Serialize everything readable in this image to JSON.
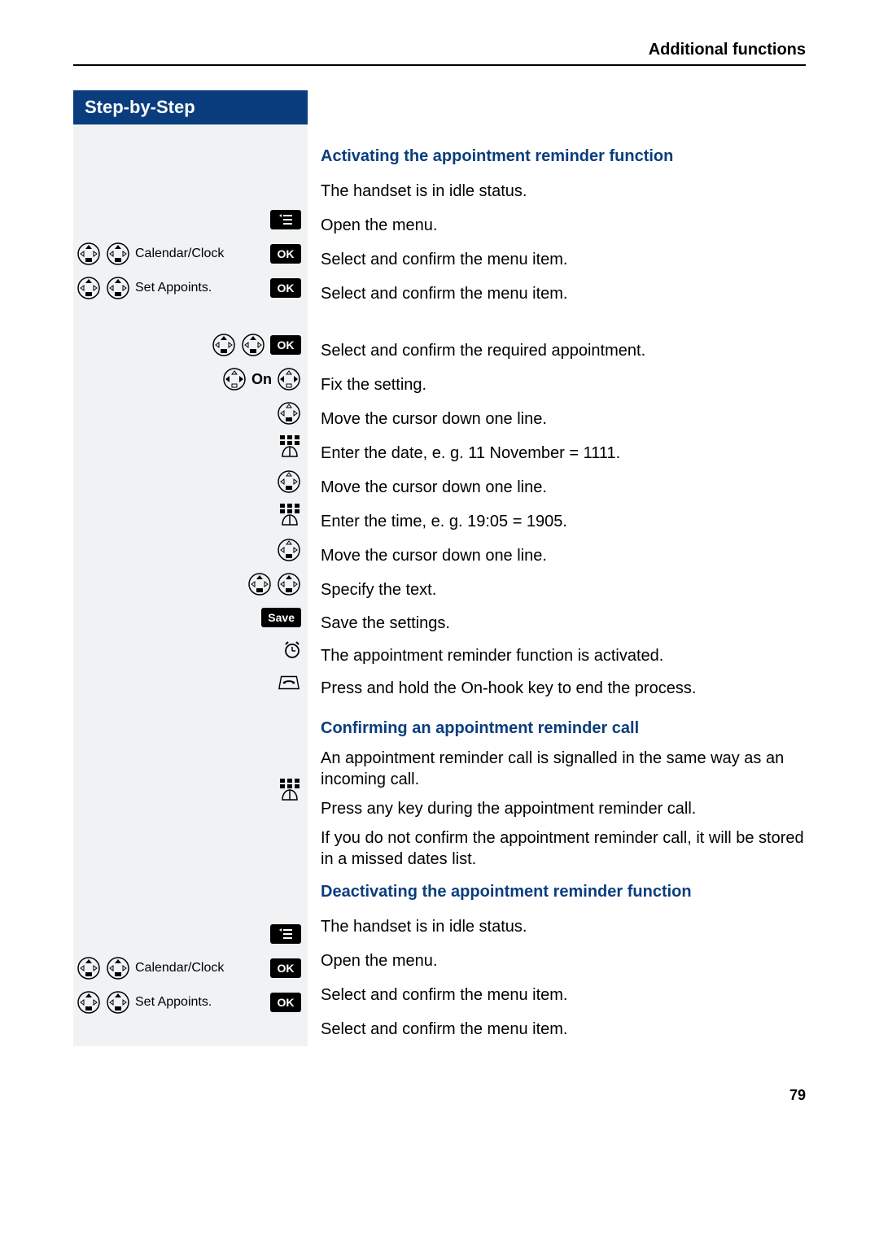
{
  "header": {
    "title": "Additional functions"
  },
  "stepBar": "Step-by-Step",
  "labels": {
    "ok": "OK",
    "save": "Save",
    "on": "On",
    "calClock": "Calendar/Clock",
    "setAppoints": "Set Appoints."
  },
  "sections": {
    "s1": {
      "title": "Activating the appointment reminder function",
      "idle": "The handset is in idle status.",
      "openMenu": "Open the menu.",
      "selectConfirm": "Select and confirm the menu item.",
      "selectAppt": "Select and confirm the required appointment.",
      "fix": "Fix the setting.",
      "moveDown": "Move the cursor down one line.",
      "enterDate": "Enter the date, e. g. 11 November = 1111.",
      "enterTime": "Enter the time, e. g. 19:05 = 1905.",
      "specifyText": "Specify the text.",
      "saveSettings": "Save the settings.",
      "activated": "The appointment reminder function is activated.",
      "onhook": "Press and hold the On-hook key to end the process."
    },
    "s2": {
      "title": "Confirming an appointment reminder call",
      "p1": "An appointment reminder call is signalled in the same way as an incoming call.",
      "p2": "Press any key during the appointment reminder call.",
      "p3": "If you do not confirm the appointment reminder call, it will be stored in a missed dates list."
    },
    "s3": {
      "title": "Deactivating the appointment reminder function",
      "idle": "The handset is in idle status.",
      "openMenu": "Open the menu.",
      "selectConfirm": "Select and confirm the menu item."
    }
  },
  "pageNumber": "79"
}
